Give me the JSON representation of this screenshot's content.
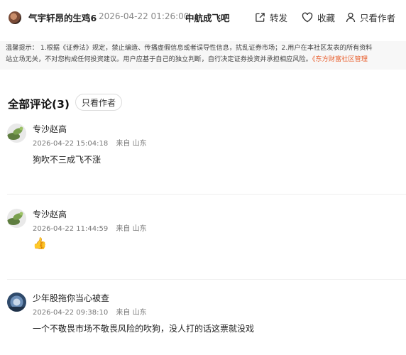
{
  "post": {
    "author": "气宇轩昂的生鸡6",
    "time": "2026-04-22 01:26:00",
    "forum": "中航成飞吧"
  },
  "actions": {
    "share": "转发",
    "favorite": "收藏",
    "author_only": "只看作者"
  },
  "notice": {
    "line1": "温馨提示：  1.根据《证券法》规定，禁止编造、传播虚假信息或者误导性信息，扰乱证券市场；2.用户在本社区发表的所有资料",
    "line2_text": "站立场无关，不对您构成任何投资建议。用户应基于自己的独立判断，自行决定证券投资并承担相应风险。",
    "line2_link": "《东方财富社区管理"
  },
  "comments_section": {
    "title": "全部评论(3)",
    "filter": "只看作者"
  },
  "comments": [
    {
      "name": "专沙赵高",
      "time": "2026-04-22 15:04:18",
      "from": "来自 山东",
      "text": "狗吹不三成飞不涨"
    },
    {
      "name": "专沙赵高",
      "time": "2026-04-22 11:44:59",
      "from": "来自 山东",
      "text": "👍"
    },
    {
      "name": "少年股拖你当心被查",
      "time": "2026-04-22 09:38:10",
      "from": "来自 山东",
      "text": "一个不敬畏市场不敬畏风险的吹狗，没人打的话这票就没戏"
    }
  ],
  "icons": {
    "share": "share-icon",
    "favorite": "heart-icon",
    "author_only": "user-icon"
  },
  "colors": {
    "notice_link": "#e85c2a",
    "notice_bg": "#f7f7f7"
  }
}
